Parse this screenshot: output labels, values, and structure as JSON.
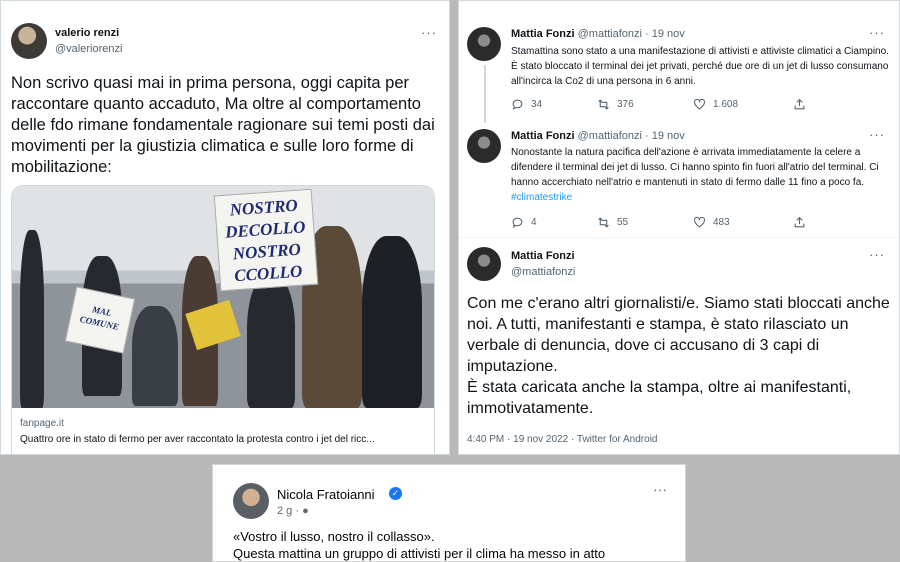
{
  "left_tweet": {
    "name": "valerio renzi",
    "handle": "@valeriorenzi",
    "more": "···",
    "text": "Non scrivo quasi mai in prima persona, oggi capita per raccontare quanto accaduto, Ma oltre al comportamento delle fdo rimane fondamentale ragionare sui temi posti dai movimenti per la giustizia climatica e sulle loro forme di mobilitazione:",
    "card": {
      "sign_big": "NOSTRO DECOLLO NOSTRO CCOLLO",
      "sign_small": "MAL COMUNE",
      "domain": "fanpage.it",
      "title": "Quattro ore in stato di fermo per aver raccontato la protesta contro i jet del ricc..."
    }
  },
  "right_thread": {
    "more": "···",
    "tweets": [
      {
        "name": "Mattia Fonzi",
        "handle": "@mattiafonzi",
        "date": "· 19 nov",
        "text": "Stamattina sono stato a una manifestazione di attivisti e attiviste climatici a Ciampino. È stato bloccato il terminal dei jet privati, perché due ore di un jet di lusso consumano all'incirca la Co2 di una persona in 6 anni.",
        "replies": "34",
        "retweets": "376",
        "likes": "1.608"
      },
      {
        "name": "Mattia Fonzi",
        "handle": "@mattiafonzi",
        "date": "· 19 nov",
        "text": "Nonostante la natura pacifica dell'azione è arrivata immediatamente la celere a difendere il terminal dei jet di lusso. Ci hanno spinto fin fuori all'atrio del terminal. Ci hanno accerchiato nell'atrio e mantenuti in stato di fermo dalle 11 fino a poco fa.",
        "hashtag": "#climatestrike",
        "replies": "4",
        "retweets": "55",
        "likes": "483"
      },
      {
        "name": "Mattia Fonzi",
        "handle": "@mattiafonzi",
        "text": "Con me c'erano altri giornalisti/e. Siamo stati bloccati anche noi. A tutti, manifestanti e stampa, è stato rilasciato un verbale di denuncia, dove ci accusano di 3 capi di imputazione.\nÈ stata caricata anche la stampa, oltre ai manifestanti, immotivatamente.",
        "meta": "4:40 PM · 19 nov 2022 · Twitter for Android"
      }
    ]
  },
  "facebook_post": {
    "name": "Nicola Fratoianni",
    "verified": "✓",
    "meta": "2 g · ",
    "more": "···",
    "line1": "«Vostro il lusso, nostro il collasso».",
    "line2": "Questa mattina un gruppo di attivisti per il clima ha messo in atto"
  },
  "colors": {
    "accent": "#1d9bf0",
    "facebook_blue": "#1877f2"
  }
}
